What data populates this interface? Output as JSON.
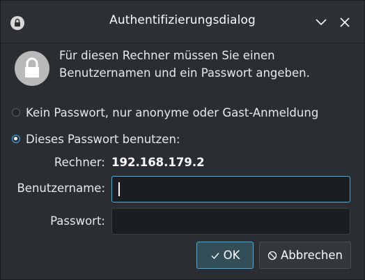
{
  "window": {
    "title": "Authentifizierungsdialog"
  },
  "message": {
    "text": "Für diesen Rechner müssen Sie einen Benutzernamen und ein Passwort angeben."
  },
  "options": {
    "anonymous_label": "Kein Passwort, nur anonyme oder Gast-Anmeldung",
    "anonymous_checked": false,
    "password_label": "Dieses Passwort benutzen:",
    "password_checked": true
  },
  "form": {
    "host_label": "Rechner:",
    "host_value": "192.168.179.2",
    "username_label": "Benutzername:",
    "username_value": "",
    "password_label": "Passwort:",
    "password_value": ""
  },
  "buttons": {
    "ok_label": "OK",
    "ok_icon": "checkmark-icon",
    "cancel_label": "Abbrechen",
    "cancel_icon": "cancel-icon"
  },
  "icons": {
    "window_icon": "lock-icon",
    "header_icon": "lock-icon",
    "minimize_icon": "chevron-down-icon",
    "close_icon": "close-icon"
  },
  "colors": {
    "window_bg": "#2a2e32",
    "accent": "#3daee9",
    "text": "#fcfcfc",
    "input_bg": "#1b1e20",
    "ok_button_bg": "#334e57"
  }
}
